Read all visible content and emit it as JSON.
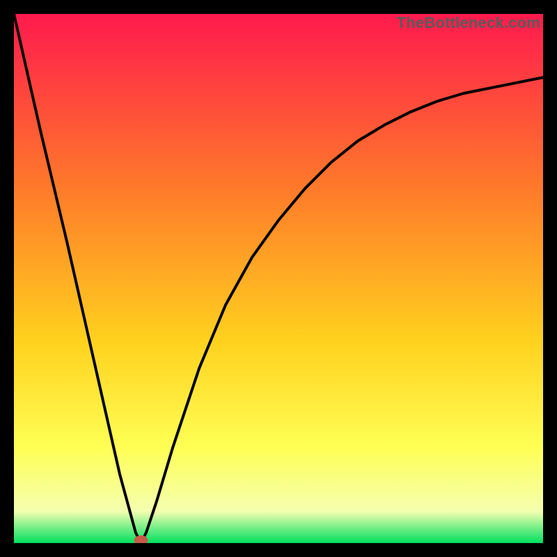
{
  "watermark_text": "TheBottleneck.com",
  "gradient": {
    "top": "#ff1a4d",
    "upper_mid": "#ff7a2a",
    "mid": "#ffd21e",
    "lower_mid": "#ffff55",
    "pale": "#f4ffb0",
    "bottom": "#00e060"
  },
  "chart_data": {
    "type": "line",
    "title": "",
    "xlabel": "",
    "ylabel": "",
    "xlim": [
      0,
      100
    ],
    "ylim": [
      0,
      100
    ],
    "grid": false,
    "legend": false,
    "annotations": [
      "TheBottleneck.com"
    ],
    "series": [
      {
        "name": "curve",
        "x": [
          0,
          5,
          10,
          15,
          20,
          23,
          24,
          25,
          27,
          30,
          35,
          40,
          45,
          50,
          55,
          60,
          65,
          70,
          75,
          80,
          85,
          90,
          95,
          100
        ],
        "values": [
          100,
          78,
          57,
          35,
          13,
          2,
          0,
          2,
          8,
          18,
          33,
          45,
          54,
          61,
          67,
          72,
          76,
          79,
          81.5,
          83.5,
          85,
          86,
          87,
          88
        ]
      },
      {
        "name": "marker",
        "x": [
          24
        ],
        "values": [
          0
        ]
      }
    ]
  }
}
